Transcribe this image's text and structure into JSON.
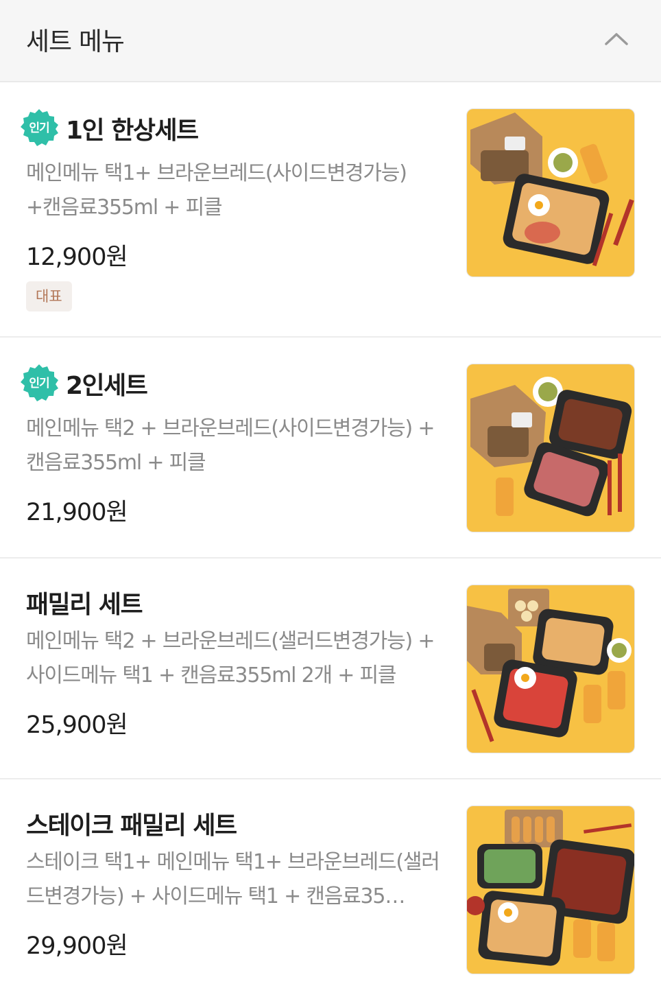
{
  "header": {
    "title": "세트 메뉴"
  },
  "badge_popular": "인기",
  "colors": {
    "popular": "#2fbfa8",
    "tag_bg": "#f3efec",
    "tag_text": "#b27656",
    "food_bg": "#f7c144"
  },
  "items": [
    {
      "name": "1인 한상세트",
      "desc": "메인메뉴 택1+ 브라운브레드(사이드변경가능) +캔음료355ml + 피클",
      "price": "12,900원",
      "tag": "대표",
      "popular": true
    },
    {
      "name": "2인세트",
      "desc": "메인메뉴 택2 + 브라운브레드(사이드변경가능) + 캔음료355ml + 피클",
      "price": "21,900원",
      "popular": true
    },
    {
      "name": "패밀리 세트",
      "desc": "메인메뉴 택2 + 브라운브레드(샐러드변경가능) + 사이드메뉴 택1 + 캔음료355ml 2개 + 피클",
      "price": "25,900원",
      "popular": false
    },
    {
      "name": "스테이크 패밀리 세트",
      "desc": "스테이크 택1+ 메인메뉴 택1+ 브라운브레드(샐러드변경가능) + 사이드메뉴 택1 + 캔음료35…",
      "price": "29,900원",
      "popular": false
    }
  ]
}
